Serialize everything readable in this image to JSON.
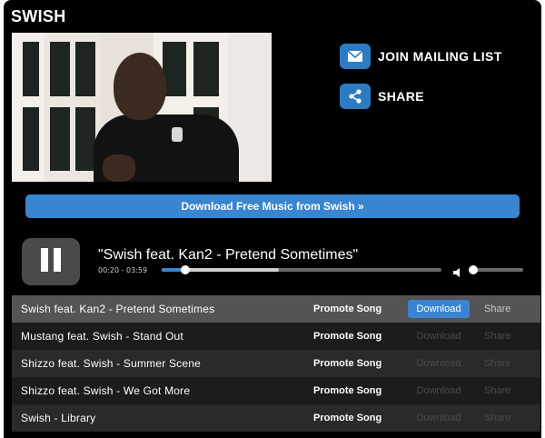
{
  "artist": {
    "name": "SWISH"
  },
  "actions": {
    "mailing_list": "JOIN MAILING LIST",
    "share": "SHARE"
  },
  "download_free_label": "Download Free Music from Swish »",
  "player": {
    "state": "playing",
    "now_playing": "\"Swish feat. Kan2 - Pretend Sometimes\"",
    "time": "00:20 - 03:59",
    "progress_fraction": 0.084,
    "loaded_fraction": 0.42,
    "volume_fraction": 0.08
  },
  "tracks": [
    {
      "title": "Swish feat. Kan2 - Pretend Sometimes",
      "promote": "Promote Song",
      "download": "Download",
      "share": "Share",
      "active": true
    },
    {
      "title": "Mustang feat. Swish - Stand Out",
      "promote": "Promote Song",
      "download": "Download",
      "share": "Share",
      "active": false
    },
    {
      "title": "Shizzo feat. Swish - Summer Scene",
      "promote": "Promote Song",
      "download": "Download",
      "share": "Share",
      "active": false
    },
    {
      "title": "Shizzo feat. Swish - We Got More",
      "promote": "Promote Song",
      "download": "Download",
      "share": "Share",
      "active": false
    },
    {
      "title": "Swish - Library",
      "promote": "Promote Song",
      "download": "Download",
      "share": "Share",
      "active": false
    }
  ],
  "colors": {
    "accent": "#3a85cf",
    "background": "#000000",
    "active_row": "#545454"
  }
}
